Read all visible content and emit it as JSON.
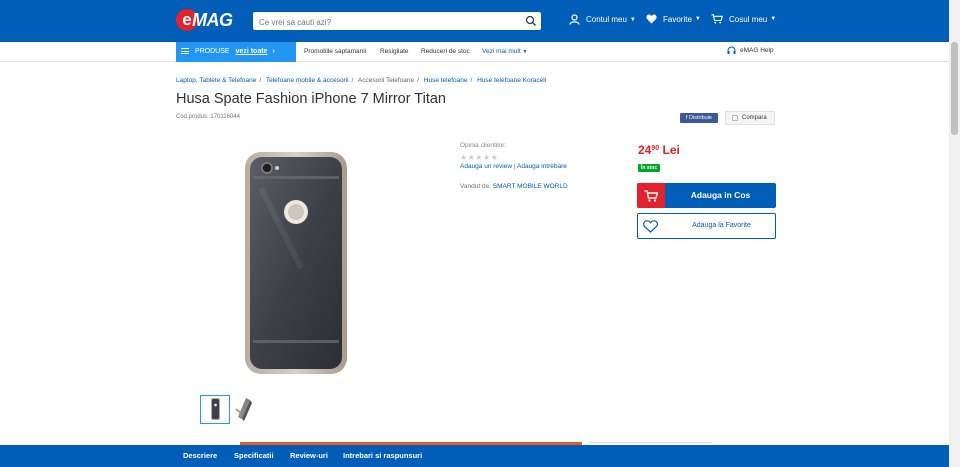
{
  "header": {
    "logo_text": "MAG",
    "logo_letter": "e",
    "search_placeholder": "Ce vrei sa cauti azi?",
    "account_label": "Contul meu",
    "favorites_label": "Favorite",
    "cart_label": "Cosul meu",
    "brand_color": "#005eb8",
    "accent_color": "#e3222b"
  },
  "subnav": {
    "produse_label": "PRODUSE",
    "vezi_toate": "vezi toate",
    "links": [
      "Promotiile saptamanii",
      "Resigilate",
      "Reduceri de stoc",
      "Vezi mai mult"
    ],
    "help_label": "eMAG Help"
  },
  "breadcrumb": [
    "Laptop, Tablete & Telefoane",
    "Telefoane mobile & accesorii",
    "Accesorii Telefoane",
    "Huse telefoane",
    "Huse telefoane Koracell"
  ],
  "product": {
    "title": "Husa Spate Fashion iPhone 7 Mirror Titan",
    "code": "Cod produs: 170116044",
    "share_label": "f Distribuie",
    "compare_label": "Compara",
    "opinion_label": "Opinia clientilor:",
    "stars": "★★★★★",
    "review_link": "Adauga un review",
    "question_link": "Adauga intrebare",
    "sold_by_label": "Vandut de:",
    "seller": "SMART MOBILE WORLD",
    "price_int": "24",
    "price_dec": "90",
    "currency": "Lei",
    "stock": "În stoc",
    "add_to_cart": "Adauga in Cos",
    "add_to_favorites": "Adauga la Favorite"
  },
  "bottom_tabs": [
    "Descriere",
    "Specificatii",
    "Review-uri",
    "Intrebari si raspunsuri"
  ]
}
